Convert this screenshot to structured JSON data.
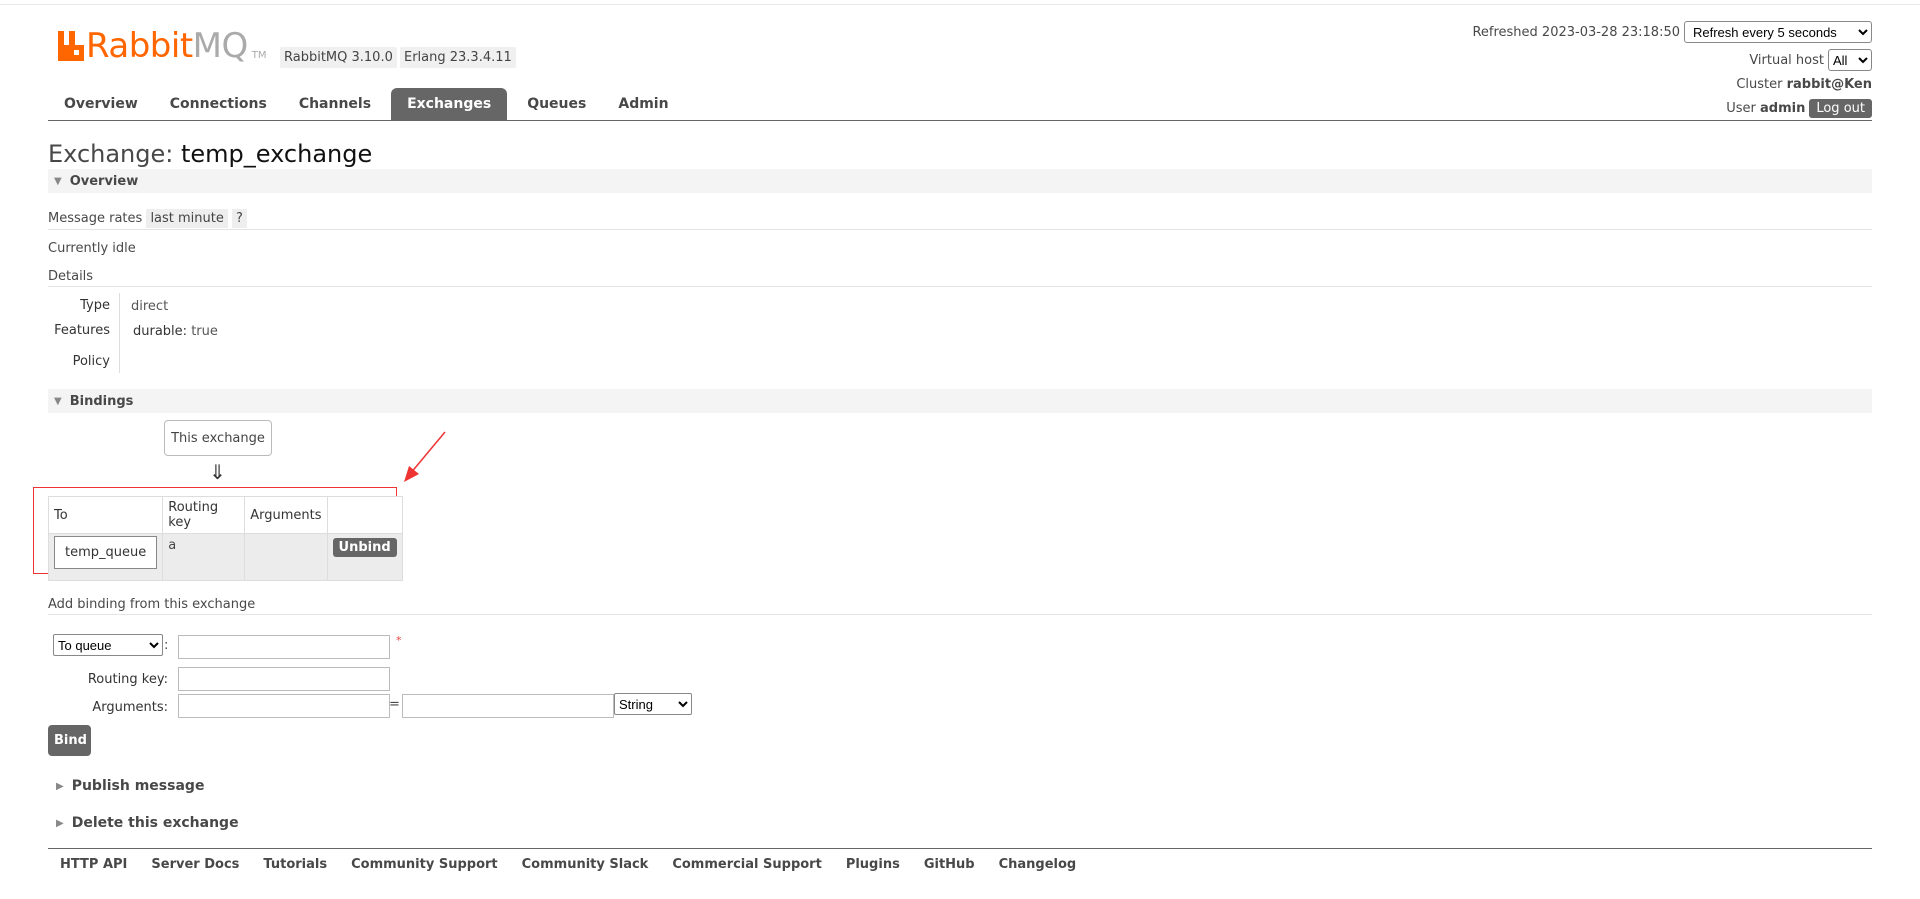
{
  "brand": {
    "name_rabbit": "Rabbit",
    "name_mq": "MQ",
    "tm": "TM",
    "version_rabbitmq": "RabbitMQ 3.10.0",
    "version_erlang": "Erlang 23.3.4.11"
  },
  "header": {
    "refreshed_label": "Refreshed 2023-03-28 23:18:50",
    "refresh_select_value": "Refresh every 5 seconds",
    "vhost_label": "Virtual host",
    "vhost_value": "All",
    "cluster_label": "Cluster",
    "cluster_value": "rabbit@Ken",
    "user_label": "User",
    "user_value": "admin",
    "logout_label": "Log out"
  },
  "tabs": [
    {
      "label": "Overview"
    },
    {
      "label": "Connections"
    },
    {
      "label": "Channels"
    },
    {
      "label": "Exchanges",
      "active": true
    },
    {
      "label": "Queues"
    },
    {
      "label": "Admin"
    }
  ],
  "page": {
    "title_prefix": "Exchange:",
    "exchange_name": "temp_exchange"
  },
  "overview": {
    "heading": "Overview",
    "message_rates_label": "Message rates",
    "message_rates_period": "last minute",
    "help": "?",
    "status": "Currently idle",
    "details_label": "Details",
    "type_key": "Type",
    "type_val": "direct",
    "features_key": "Features",
    "features_name": "durable:",
    "features_val": "true",
    "policy_key": "Policy"
  },
  "bindings": {
    "heading": "Bindings",
    "this_exchange": "This exchange",
    "arrow": "⇓",
    "columns": [
      "To",
      "Routing key",
      "Arguments",
      ""
    ],
    "rows": [
      {
        "to": "temp_queue",
        "routing_key": "a",
        "arguments": "",
        "action": "Unbind"
      }
    ]
  },
  "add_binding": {
    "heading": "Add binding from this exchange",
    "destination_type": "To queue",
    "required_mark": "*",
    "colon": ":",
    "routing_key_label": "Routing key:",
    "arguments_label": "Arguments:",
    "equals": "=",
    "arg_type": "String",
    "bind_label": "Bind"
  },
  "folds": {
    "publish": "Publish message",
    "delete": "Delete this exchange"
  },
  "footer": [
    "HTTP API",
    "Server Docs",
    "Tutorials",
    "Community Support",
    "Community Slack",
    "Commercial Support",
    "Plugins",
    "GitHub",
    "Changelog"
  ],
  "colors": {
    "brand_orange": "#ff6600",
    "tab_active": "#666666",
    "annotation_red": "#ee3333"
  }
}
